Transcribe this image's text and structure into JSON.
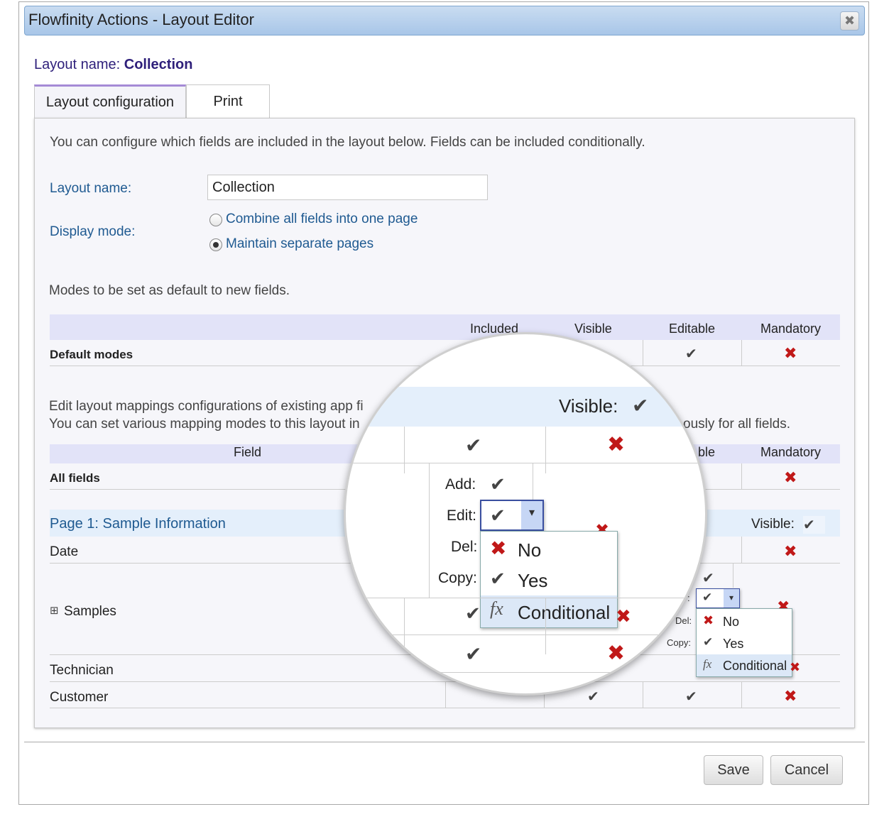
{
  "window": {
    "title": "Flowfinity Actions - Layout Editor",
    "close_glyph": "✖"
  },
  "layout_name_label": "Layout name:",
  "layout_name_value": "Collection",
  "tabs": [
    {
      "label": "Layout configuration"
    },
    {
      "label": "Print"
    }
  ],
  "intro_text": "You can configure which fields are included in the layout below. Fields can be included conditionally.",
  "form": {
    "layout_name_label": "Layout name:",
    "layout_name_value": "Collection",
    "display_mode_label": "Display mode:",
    "display_modes": [
      {
        "label": "Combine all fields into one page",
        "selected": false
      },
      {
        "label": "Maintain separate pages",
        "selected": true
      }
    ]
  },
  "defaults_text": "Modes to be set as default to new fields.",
  "defaults_table": {
    "headers": [
      "Included",
      "Visible",
      "Editable",
      "Mandatory"
    ],
    "row_label": "Default modes"
  },
  "mappings_text_1": "Edit layout mappings configurations of existing app fi",
  "mappings_text_2": "You can set various mapping modes to this layout in",
  "mappings_text_2_tail": "ously for all fields.",
  "mappings_table": {
    "headers": {
      "field": "Field",
      "editable_partial": "ble",
      "mandatory": "Mandatory"
    },
    "all_fields_label": "All fields",
    "page_label": "Page 1: Sample Information",
    "visible_label": "Visible:",
    "rows": [
      "Date",
      "Samples",
      "Technician",
      "Customer"
    ],
    "expand_glyph": "⊞"
  },
  "small_dropdown": {
    "edit_partial": ":",
    "del_label": "Del:",
    "copy_label": "Copy:",
    "options": [
      {
        "label": "No",
        "icon": "x-icon"
      },
      {
        "label": "Yes",
        "icon": "check-icon"
      },
      {
        "label": "Conditional",
        "icon": "fx-icon",
        "highlighted": true
      }
    ]
  },
  "magnifier": {
    "visible_label": "Visible:",
    "add_label": "Add:",
    "edit_label": "Edit:",
    "del_label": "Del:",
    "copy_label": "Copy:",
    "options": [
      {
        "label": "No",
        "icon": "x-icon"
      },
      {
        "label": "Yes",
        "icon": "check-icon"
      },
      {
        "label": "Conditional",
        "icon": "fx-icon",
        "highlighted": true
      }
    ]
  },
  "glyphs": {
    "check": "✔",
    "cross": "✖",
    "fx": "fx",
    "caret": "▾"
  },
  "footer": {
    "save_label": "Save",
    "cancel_label": "Cancel"
  },
  "colors": {
    "accent_purple": "#2e1f7a",
    "label_blue": "#1f5a91",
    "header_row": "#e2e3f8",
    "cross_red": "#c01818"
  }
}
